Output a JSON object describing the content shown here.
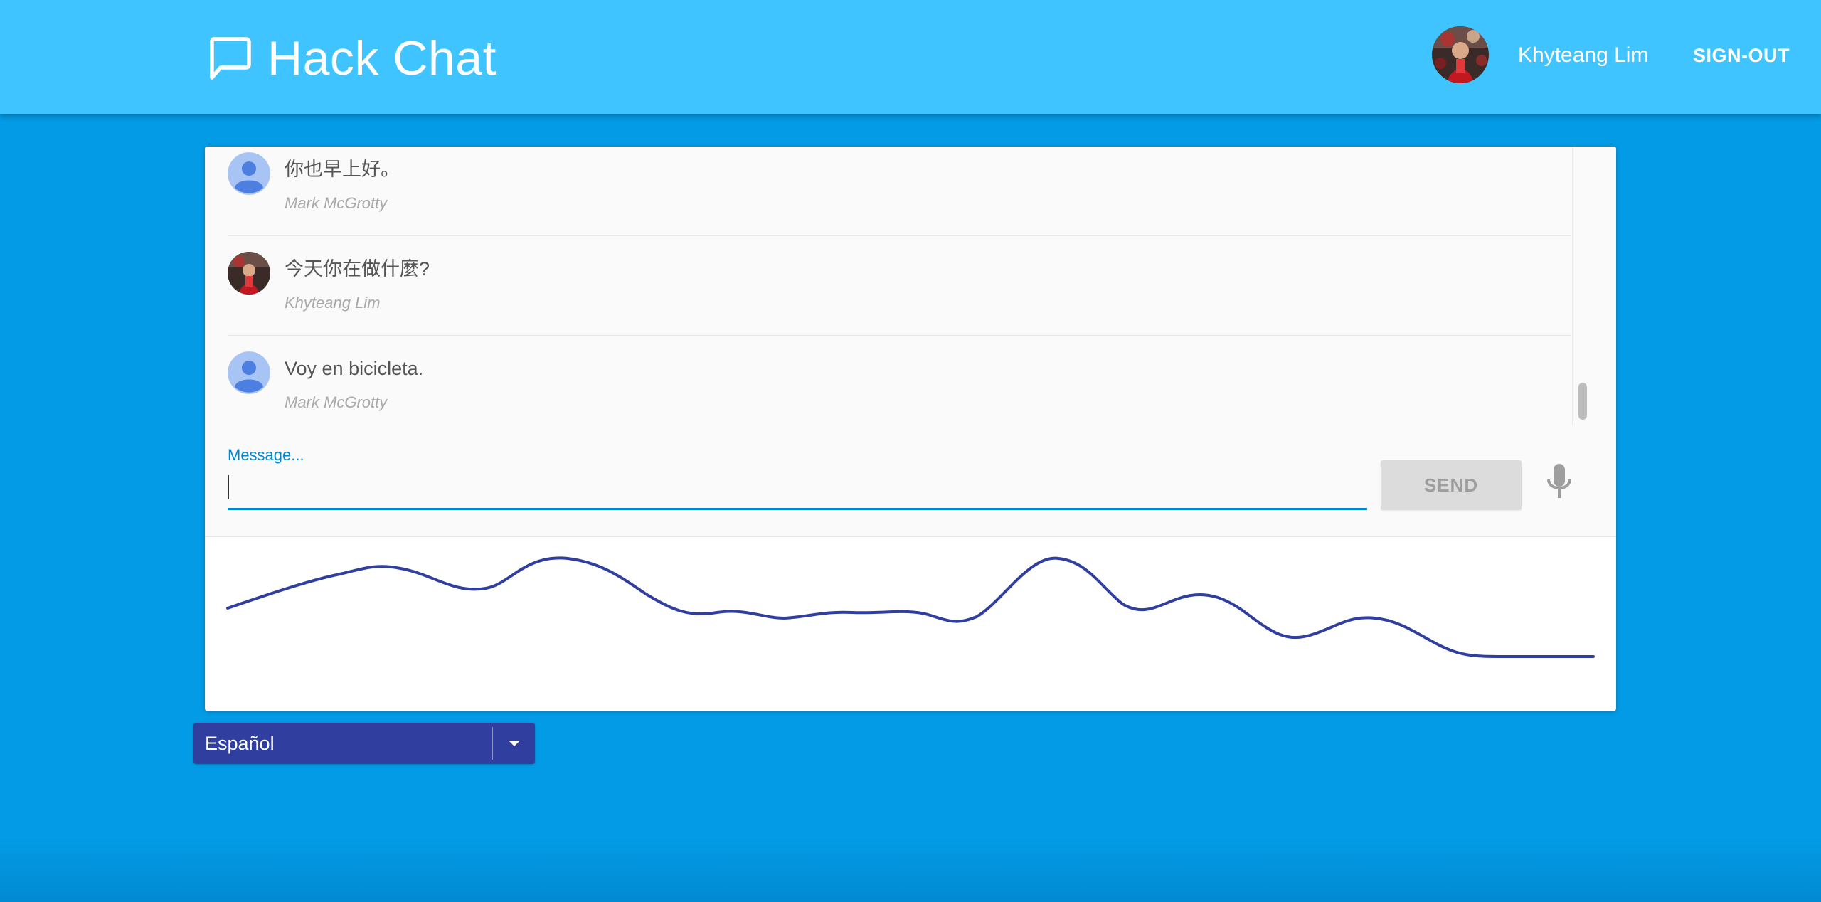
{
  "header": {
    "title": "Hack Chat",
    "brand_icon": "chat-bubble-icon",
    "user_name": "Khyteang Lim",
    "sign_out_label": "SIGN-OUT",
    "background_color": "#40c4ff"
  },
  "messages": [
    {
      "text": "你也早上好。",
      "author": "Mark McGrotty",
      "avatar": "default-user-avatar"
    },
    {
      "text": "今天你在做什麼?",
      "author": "Khyteang Lim",
      "avatar": "user-photo-avatar"
    },
    {
      "text": "Voy en bicicleta.",
      "author": "Mark McGrotty",
      "avatar": "default-user-avatar"
    }
  ],
  "composer": {
    "label": "Message...",
    "value": "",
    "send_label": "SEND",
    "mic_icon": "microphone-icon"
  },
  "language_select": {
    "selected": "Español",
    "arrow_icon": "caret-down-icon"
  },
  "colors": {
    "page_background": "#039be5",
    "accent": "#0288d1",
    "select_background": "#303f9f",
    "waveform": "#303f9f"
  }
}
